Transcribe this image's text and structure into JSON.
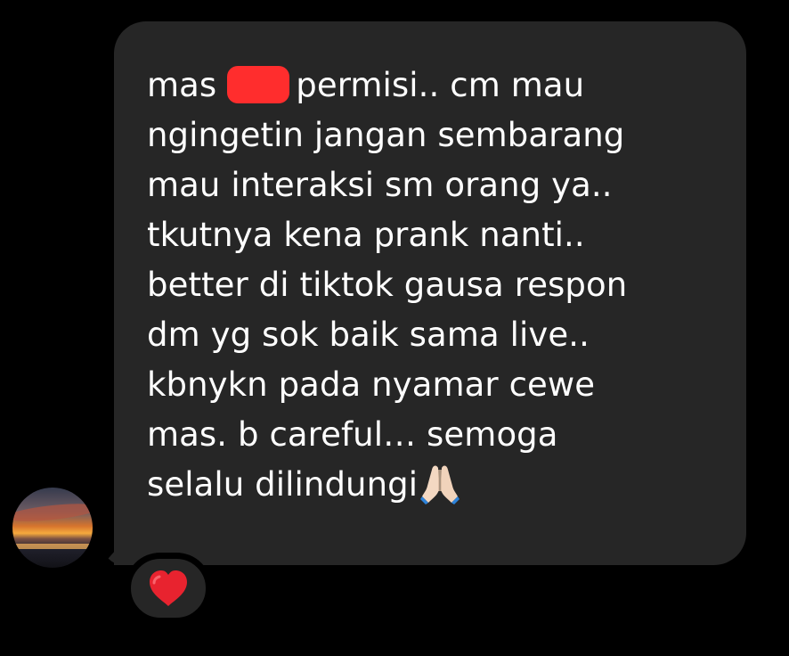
{
  "message": {
    "lines": [
      {
        "before_redaction": "mas",
        "after_redaction": "permisi.. cm mau"
      },
      "ngingetin jangan sembarang",
      "mau interaksi sm orang ya..",
      "tkutnya kena prank nanti..",
      "better di tiktok gausa respon",
      "dm yg sok baik sama live..",
      "kbnykn pada nyamar cewe",
      "mas. b careful… semoga",
      "selalu dilindungi"
    ],
    "trailing_emoji": "pray-icon"
  },
  "avatar": {
    "icon": "sunset-avatar"
  },
  "reaction": {
    "icon": "heart-icon"
  },
  "colors": {
    "background": "#000000",
    "bubble": "#262626",
    "text": "#ffffff",
    "redaction": "#ff2d2d",
    "heart": "#e8232f"
  }
}
